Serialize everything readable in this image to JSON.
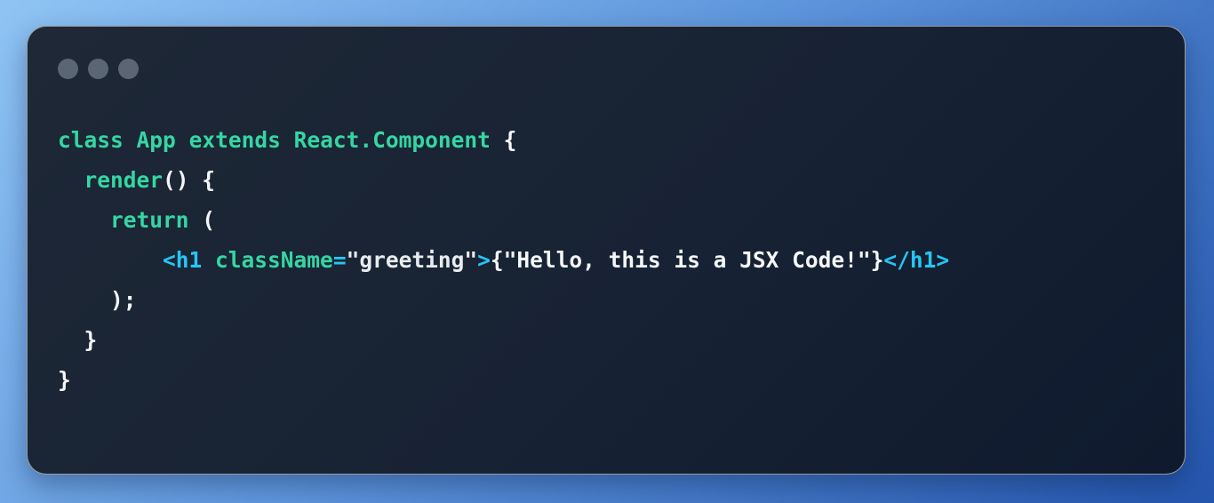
{
  "window": {
    "controls": [
      "window-dot",
      "window-dot",
      "window-dot"
    ]
  },
  "code": {
    "line1": {
      "kw1": "class",
      "name": "App",
      "kw2": "extends",
      "base": "React.Component",
      "brace": "{"
    },
    "line2": {
      "indent": "  ",
      "method": "render",
      "rest": "() {"
    },
    "line3": {
      "indent": "    ",
      "kw": "return",
      "rest": " ("
    },
    "line4": {
      "indent": "        ",
      "open_tag": "<h1",
      "attr": "className",
      "eq": "=",
      "value": "\"greeting\"",
      "open_tag_end": ">",
      "expr": "{\"Hello, this is a JSX Code!\"}",
      "close_tag": "</h1>"
    },
    "line5": {
      "indent": "    ",
      "text": ");"
    },
    "line6": {
      "indent": "  ",
      "text": "}"
    },
    "line7": {
      "text": "}"
    }
  },
  "colors": {
    "keyword": "#35d6a4",
    "tag": "#25c6f4",
    "text": "#f4f6f8",
    "window_bg": "#172234",
    "dot": "#5b6675"
  }
}
